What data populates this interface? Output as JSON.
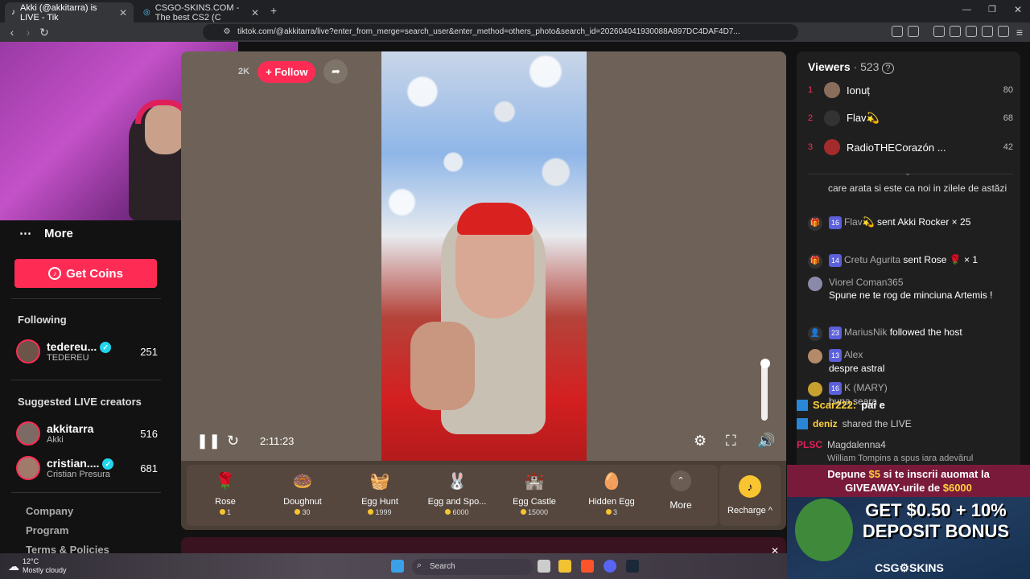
{
  "browser": {
    "tabs": [
      {
        "title": "Akki (@akkitarra) is LIVE - Tik",
        "active": true
      },
      {
        "title": "CSGO-SKINS.COM - The best CS2 (C",
        "active": false
      }
    ],
    "new_tab": "+",
    "url": "tiktok.com/@akkitarra/live?enter_from_merge=search_user&enter_method=others_photo&search_id=202604041930088A897DC4DAF4D7..."
  },
  "sidebar": {
    "more_label": "More",
    "get_coins_label": "Get Coins",
    "following_header": "Following",
    "following": [
      {
        "name": "tedereu...",
        "sub": "TEDEREU",
        "count": "251"
      }
    ],
    "suggested_header": "Suggested LIVE creators",
    "suggested": [
      {
        "name": "akkitarra",
        "sub": "Akki",
        "count": "516"
      },
      {
        "name": "cristian....",
        "sub": "Cristian Presura",
        "count": "681"
      }
    ],
    "footer_links": [
      "Company",
      "Program",
      "Terms & Policies"
    ]
  },
  "player": {
    "follower_count": "2K",
    "follow_label": "+ Follow",
    "elapsed_time": "2:11:23",
    "volume_level": 0.95
  },
  "gifts": [
    {
      "name": "Rose",
      "price": "1",
      "icon": "rose-icon",
      "glyph": "🌹"
    },
    {
      "name": "Doughnut",
      "price": "30",
      "icon": "doughnut-icon",
      "glyph": "🍩"
    },
    {
      "name": "Egg Hunt",
      "price": "1999",
      "icon": "egg-basket-icon",
      "glyph": "🧺"
    },
    {
      "name": "Egg and Spo...",
      "price": "6000",
      "icon": "bunny-icon",
      "glyph": "🐰"
    },
    {
      "name": "Egg Castle",
      "price": "15000",
      "icon": "castle-icon",
      "glyph": "🏰"
    },
    {
      "name": "Hidden Egg",
      "price": "3",
      "icon": "egg-icon",
      "glyph": "🥚"
    }
  ],
  "gift_more_label": "More",
  "recharge_label": "Recharge ^",
  "chat": {
    "viewers_label": "Viewers",
    "viewers_count": "· 523",
    "top_viewers": [
      {
        "rank": "1",
        "name": "Ionuț",
        "score": "80"
      },
      {
        "rank": "2",
        "name": "Flav💫",
        "score": "68"
      },
      {
        "rank": "3",
        "name": "RadioTHECorazón ...",
        "score": "42"
      }
    ],
    "messages": [
      {
        "user": "",
        "badge": "",
        "text": "care arata si este ca noi in zilele de astăzi"
      },
      {
        "user": "Flav💫",
        "badge": "16",
        "text": "sent Akki Rocker × 25"
      },
      {
        "user": "Cretu Agurita",
        "badge": "14",
        "text": "sent Rose 🌹 × 1"
      },
      {
        "user": "Viorel Coman365",
        "badge": "",
        "text": "Spune ne te rog de minciuna Artemis !"
      },
      {
        "user": "MariusNik",
        "badge": "23",
        "text": "followed the host"
      },
      {
        "user": "Alex",
        "badge": "13",
        "text": "despre astral"
      },
      {
        "user": "K (MARY)",
        "badge": "16",
        "text": "buna seara"
      }
    ]
  },
  "overlay_chat": [
    {
      "user": "Scar222:",
      "text": "pai e"
    },
    {
      "user": "deniz",
      "text": "shared the LIVE"
    },
    {
      "user": "",
      "text": "Magdalenna4"
    },
    {
      "user": "",
      "text": "William Tompins a spus iara adevărul"
    }
  ],
  "ad": {
    "line1_pre": "Depune ",
    "line1_amount": "$5",
    "line1_post": " si te inscrii auomat la",
    "line2_pre": "GIVEAWAY-urile de ",
    "line2_amount": "$6000",
    "headline": "GET $0.50 + 10% DEPOSIT BONUS",
    "brand": "CSG⚙SKINS",
    "accent": "#ffd23a"
  },
  "taskbar": {
    "temp": "12°C",
    "weather": "Mostly cloudy",
    "search": "Search"
  },
  "colors": {
    "accent": "#fe2c55",
    "coin": "#f8c42f"
  }
}
